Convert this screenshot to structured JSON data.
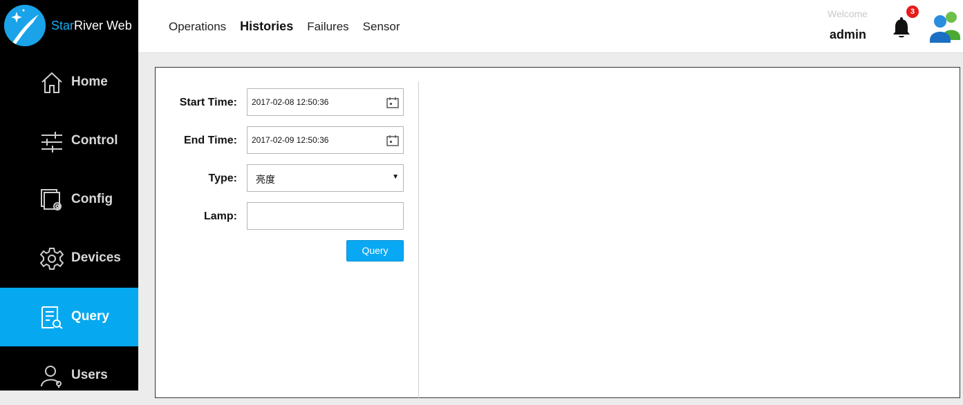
{
  "brand": {
    "name_accent": "Star",
    "name_rest": "River Web"
  },
  "topnav": [
    {
      "label": "Operations"
    },
    {
      "label": "Histories"
    },
    {
      "label": "Failures"
    },
    {
      "label": "Sensor"
    }
  ],
  "user": {
    "welcome": "Welcome",
    "name": "admin",
    "notifications": "3"
  },
  "sidebar": {
    "items": [
      {
        "label": "Home",
        "icon": "home-icon"
      },
      {
        "label": "Control",
        "icon": "sliders-icon"
      },
      {
        "label": "Config",
        "icon": "config-icon"
      },
      {
        "label": "Devices",
        "icon": "gear-icon"
      },
      {
        "label": "Query",
        "icon": "query-doc-icon"
      },
      {
        "label": "Users",
        "icon": "user-icon"
      }
    ],
    "active": "Query"
  },
  "form": {
    "start_label": "Start Time:",
    "start_value": "2017-02-08 12:50:36",
    "end_label": "End Time:",
    "end_value": "2017-02-09 12:50:36",
    "type_label": "Type:",
    "type_value": "亮度",
    "lamp_label": "Lamp:",
    "lamp_value": "",
    "query_button": "Query"
  },
  "colors": {
    "accent": "#06a9f0",
    "sidebar_bg": "#000000",
    "badge": "#e81b1b"
  }
}
